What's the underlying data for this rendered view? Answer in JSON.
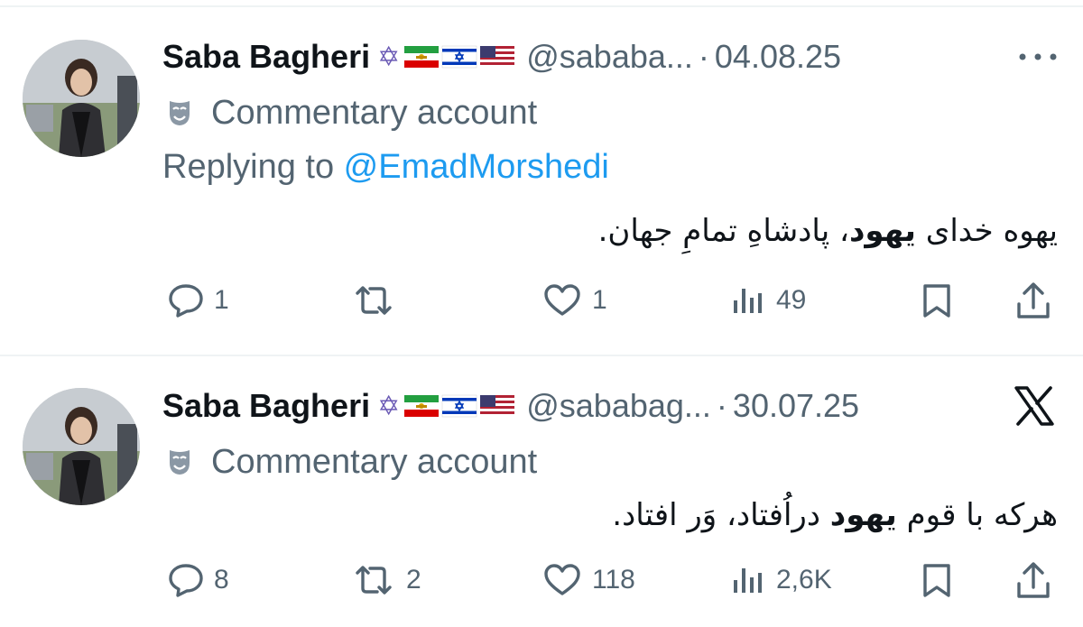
{
  "tweets": [
    {
      "display_name": "Saba Bagheri",
      "emojis": [
        "✡",
        "lion-and-sun-flag",
        "israel-flag",
        "us-flag"
      ],
      "handle": "@sababa...",
      "separator": "·",
      "date": "04.08.25",
      "account_label": "Commentary account",
      "replying_to": {
        "prefix": "Replying to ",
        "mention": "@EmadMorshedi"
      },
      "text": {
        "part1": "یهوه خدای ",
        "bold": "یهود",
        "part2": "، پادشاهِ تمامِ جهان."
      },
      "actions": {
        "replies": "1",
        "reposts": "",
        "likes": "1",
        "views": "49"
      },
      "top_right": "more-icon"
    },
    {
      "display_name": "Saba Bagheri",
      "emojis": [
        "✡",
        "lion-and-sun-flag",
        "israel-flag",
        "us-flag"
      ],
      "handle": "@sababag...",
      "separator": "·",
      "date": "30.07.25",
      "account_label": "Commentary account",
      "text": {
        "part1": "هرکه با قوم ",
        "bold": "یهود",
        "part2": " دراُفتاد، وَر افتاد."
      },
      "actions": {
        "replies": "8",
        "reposts": "2",
        "likes": "118",
        "views": "2,6K"
      },
      "top_right": "x-logo"
    }
  ],
  "colors": {
    "text": "#0f1419",
    "muted": "#536471",
    "link": "#1d9bf0",
    "divider": "#eff3f4"
  }
}
